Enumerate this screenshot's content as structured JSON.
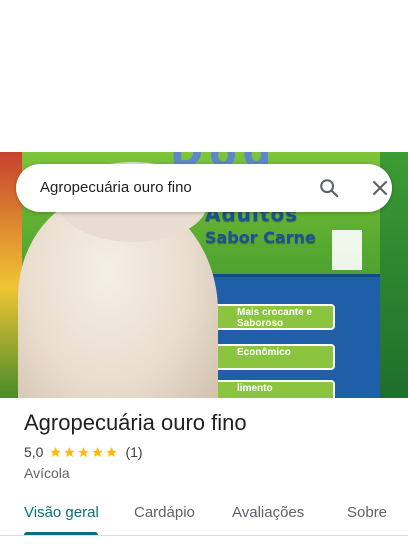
{
  "search": {
    "query": "Agropecuária ouro fino"
  },
  "place": {
    "name": "Agropecuária ouro fino",
    "rating": "5,0",
    "rating_value": 5,
    "review_count": "(1)",
    "category": "Avícola"
  },
  "photo": {
    "brand_text": "Dog",
    "line1": "Adultos",
    "line2": "Sabor Carne",
    "pill1": "Mais crocante e Saboroso",
    "pill2": "Econômico",
    "pill3": "limento"
  },
  "tabs": [
    {
      "label": "Visão geral",
      "active": true
    },
    {
      "label": "Cardápio",
      "active": false
    },
    {
      "label": "Avaliações",
      "active": false
    },
    {
      "label": "Sobre",
      "active": false
    }
  ],
  "colors": {
    "accent": "#0b6e7a",
    "star": "#fbbc04"
  }
}
